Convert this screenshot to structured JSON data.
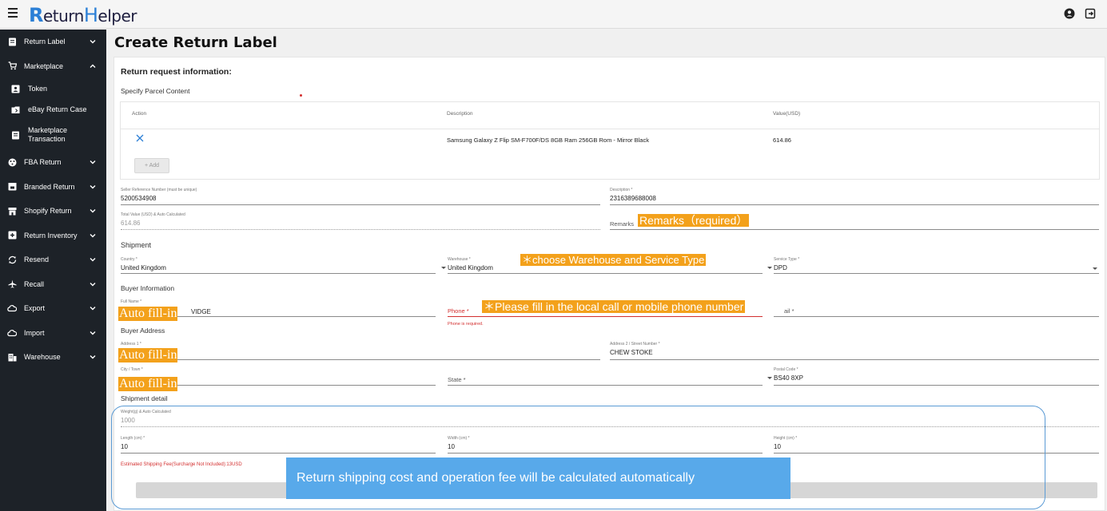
{
  "app": {
    "logo_initial": "R",
    "logo_rest": "eturn",
    "logo_initial2": "H",
    "logo_rest2": "elper"
  },
  "sidebar": {
    "items": [
      {
        "label": "Return Label",
        "icon": "label-icon",
        "expanded": false
      },
      {
        "label": "Marketplace",
        "icon": "cart-icon",
        "expanded": true
      },
      {
        "label": "FBA Return",
        "icon": "fba-icon",
        "expanded": false
      },
      {
        "label": "Branded Return",
        "icon": "branded-icon",
        "expanded": false
      },
      {
        "label": "Shopify Return",
        "icon": "shop-icon",
        "expanded": false
      },
      {
        "label": "Return Inventory",
        "icon": "inventory-icon",
        "expanded": false
      },
      {
        "label": "Resend",
        "icon": "resend-icon",
        "expanded": false
      },
      {
        "label": "Recall",
        "icon": "plane-icon",
        "expanded": false
      },
      {
        "label": "Export",
        "icon": "cloud-icon",
        "expanded": false
      },
      {
        "label": "Import",
        "icon": "cloud-icon",
        "expanded": false
      },
      {
        "label": "Warehouse",
        "icon": "warehouse-icon",
        "expanded": false
      }
    ],
    "marketplace_sub": [
      {
        "label": "Token",
        "icon": "token-icon"
      },
      {
        "label": "eBay Return Case",
        "icon": "ebay-icon"
      },
      {
        "label_line1": "Marketplace",
        "label_line2": "Transaction",
        "icon": "transaction-icon"
      }
    ]
  },
  "page": {
    "title": "Create Return Label"
  },
  "form": {
    "section_title": "Return request information:",
    "parcel_title": "Specify Parcel Content",
    "parcel_table": {
      "headers": [
        "Action",
        "Description",
        "Value(USD)"
      ],
      "rows": [
        {
          "description": "Samsung Galaxy Z Flip SM-F700F/DS 8GB Ram 256GB Rom - Mirror Black",
          "value": "614.86"
        }
      ],
      "add_label": "+ Add"
    },
    "seller_ref": {
      "label": "Seller Reference Number (must be unique)",
      "value": "5200534908"
    },
    "description": {
      "label": "Description *",
      "value": "2316389688008"
    },
    "total_value": {
      "label": "Total Value (USD) & Auto Calculated",
      "value": "614.86"
    },
    "remarks": {
      "placeholder": "Remarks"
    },
    "shipment_title": "Shipment",
    "country": {
      "label": "Country *",
      "value": "United Kingdom"
    },
    "warehouse": {
      "label": "Warehouse *",
      "value": "United Kingdom"
    },
    "service_type": {
      "label": "Service Type *",
      "value": "DPD"
    },
    "buyer_info_title": "Buyer Information",
    "full_name": {
      "label": "Full Name *",
      "value_suffix": "VIDGE"
    },
    "phone": {
      "placeholder": "Phone *",
      "error": "Phone is required."
    },
    "email": {
      "placeholder_suffix": "ail *"
    },
    "buyer_address_title": "Buyer Address",
    "address1": {
      "label": "Address 1 *"
    },
    "address2": {
      "label": "Address 2 / Street Number *",
      "value": "CHEW STOKE"
    },
    "city": {
      "label": "City / Town *"
    },
    "state": {
      "placeholder": "State *"
    },
    "postal": {
      "label": "Postal Code *",
      "value": "BS40 8XP"
    },
    "shipment_detail_title": "Shipment detail",
    "weight": {
      "label": "Weight(g) & Auto Calculated",
      "value": "1000"
    },
    "length": {
      "label": "Length (cm) *",
      "value": "10"
    },
    "width": {
      "label": "Width (cm) *",
      "value": "10"
    },
    "height": {
      "label": "Height (cm) *",
      "value": "10"
    },
    "est_fee": "Estimated Shipping Fee(Surcharge Not Included):13USD"
  },
  "annotations": {
    "remarks_required": "Remarks（required）",
    "choose_warehouse": "＊choose Warehouse and Service Type",
    "phone_hint": "＊Please fill in the local call or mobile phone number",
    "auto_fill_1": "Auto  fill-in",
    "auto_fill_2": "Auto  fill-in",
    "auto_fill_3": "Auto  fill-in",
    "cost_callout": "Return shipping cost and operation fee will be calculated automatically"
  },
  "colors": {
    "sidebar_bg": "#1d2228",
    "highlight": "#f3a11b",
    "callout": "#58a9ea",
    "error": "#d32f2f"
  }
}
